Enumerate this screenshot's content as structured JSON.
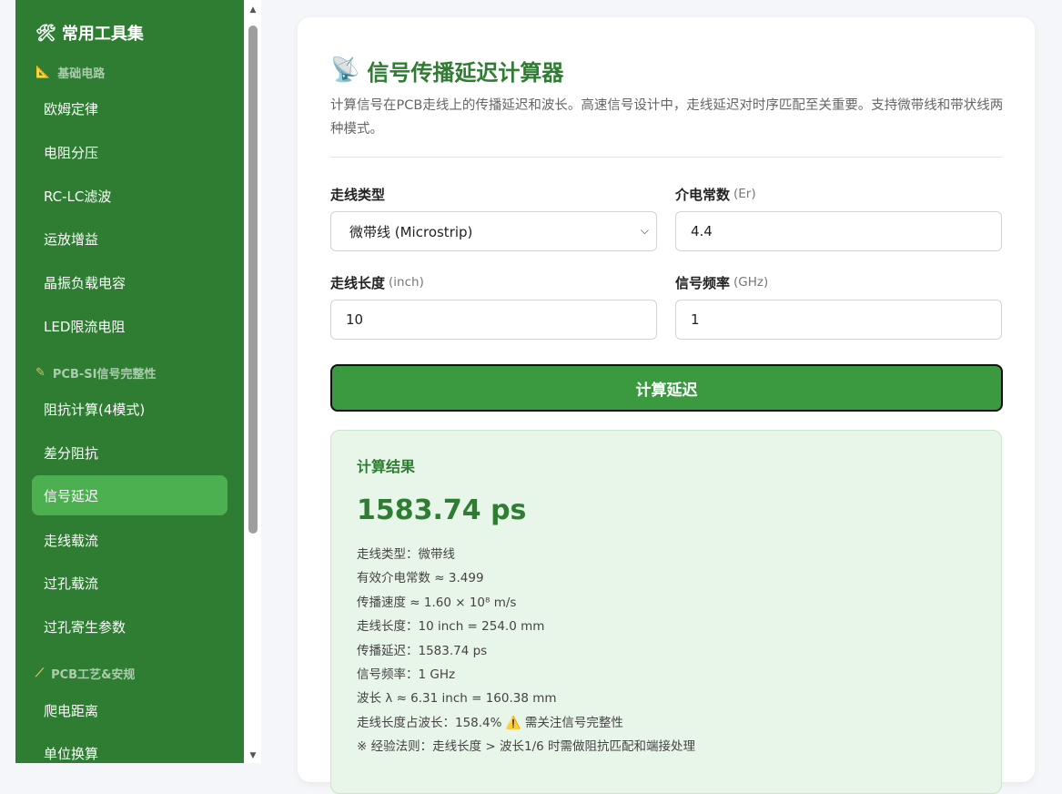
{
  "sidebar": {
    "title_icon": "🛠",
    "title": "常用工具集",
    "sections": [
      {
        "icon": "📐",
        "label": "基础电路",
        "items": [
          "欧姆定律",
          "电阻分压",
          "RC-LC滤波",
          "运放增益",
          "晶振负载电容",
          "LED限流电阻"
        ]
      },
      {
        "icon": "✎",
        "label": "PCB-SI信号完整性",
        "items": [
          "阻抗计算(4模式)",
          "差分阻抗",
          "信号延迟",
          "走线载流",
          "过孔载流",
          "过孔寄生参数"
        ]
      },
      {
        "icon": "⟋",
        "label": "PCB工艺&安规",
        "items": [
          "爬电距离",
          "单位换算"
        ]
      }
    ],
    "active_item": "信号延迟"
  },
  "main": {
    "title_icon": "📡",
    "title": "信号传播延迟计算器",
    "description": "计算信号在PCB走线上的传播延迟和波长。高速信号设计中，走线延迟对时序匹配至关重要。支持微带线和带状线两种模式。",
    "fields": {
      "trace_type": {
        "label": "走线类型",
        "unit": "",
        "value": "微带线 (Microstrip)"
      },
      "dielectric": {
        "label": "介电常数",
        "unit": "(Er)",
        "value": "4.4"
      },
      "length": {
        "label": "走线长度",
        "unit": "(inch)",
        "value": "10"
      },
      "frequency": {
        "label": "信号频率",
        "unit": "(GHz)",
        "value": "1"
      }
    },
    "calc_button": "计算延迟",
    "result": {
      "title": "计算结果",
      "value": "1583.74 ps",
      "lines": [
        "走线类型：微带线",
        "有效介电常数 ≈ 3.499",
        "传播速度 ≈ 1.60 × 10⁸ m/s",
        "走线长度：10 inch = 254.0 mm",
        "传播延迟：1583.74 ps",
        "信号频率：1 GHz",
        "波长 λ ≈ 6.31 inch = 160.38 mm"
      ],
      "ratio_line": "走线长度占波长：158.4%",
      "warning_icon": "⚠️",
      "warning_text": "需关注信号完整性",
      "rule_line": "※ 经验法则：走线长度 > 波长1/6 时需做阻抗匹配和端接处理"
    }
  }
}
